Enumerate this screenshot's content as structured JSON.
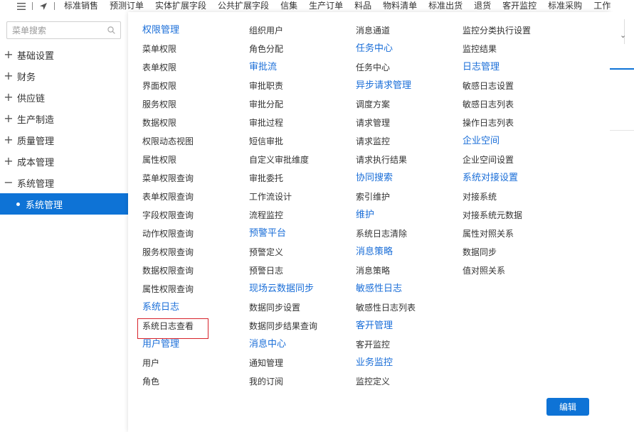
{
  "topbar": {
    "tabs": [
      "标准销售",
      "预测订单",
      "实体扩展字段",
      "公共扩展字段",
      "信集",
      "生产订单",
      "料品",
      "物料清单",
      "标准出货",
      "退货",
      "客开监控",
      "标准采购",
      "工作"
    ]
  },
  "sidebar": {
    "search_placeholder": "菜单搜索",
    "items": [
      {
        "icon": "+",
        "label": "基础设置"
      },
      {
        "icon": "+",
        "label": "财务"
      },
      {
        "icon": "+",
        "label": "供应链"
      },
      {
        "icon": "+",
        "label": "生产制造"
      },
      {
        "icon": "+",
        "label": "质量管理"
      },
      {
        "icon": "+",
        "label": "成本管理"
      },
      {
        "icon": "−",
        "label": "系统管理"
      }
    ],
    "active_item": "系统管理"
  },
  "menu": {
    "columns": [
      [
        {
          "type": "head",
          "text": "权限管理"
        },
        {
          "type": "link",
          "text": "菜单权限"
        },
        {
          "type": "link",
          "text": "表单权限"
        },
        {
          "type": "link",
          "text": "界面权限"
        },
        {
          "type": "link",
          "text": "服务权限"
        },
        {
          "type": "link",
          "text": "数据权限"
        },
        {
          "type": "link",
          "text": "权限动态视图"
        },
        {
          "type": "link",
          "text": "属性权限"
        },
        {
          "type": "link",
          "text": "菜单权限查询"
        },
        {
          "type": "link",
          "text": "表单权限查询"
        },
        {
          "type": "link",
          "text": "字段权限查询"
        },
        {
          "type": "link",
          "text": "动作权限查询"
        },
        {
          "type": "link",
          "text": "服务权限查询"
        },
        {
          "type": "link",
          "text": "数据权限查询"
        },
        {
          "type": "link",
          "text": "属性权限查询"
        },
        {
          "type": "head",
          "text": "系统日志"
        },
        {
          "type": "link",
          "text": "系统日志查看"
        },
        {
          "type": "head",
          "text": "用户管理"
        },
        {
          "type": "link",
          "text": "用户"
        },
        {
          "type": "link",
          "text": "角色"
        }
      ],
      [
        {
          "type": "link",
          "text": "组织用户"
        },
        {
          "type": "link",
          "text": "角色分配"
        },
        {
          "type": "head",
          "text": "审批流"
        },
        {
          "type": "link",
          "text": "审批职责"
        },
        {
          "type": "link",
          "text": "审批分配"
        },
        {
          "type": "link",
          "text": "审批过程"
        },
        {
          "type": "link",
          "text": "短信审批"
        },
        {
          "type": "link",
          "text": "自定义审批维度"
        },
        {
          "type": "link",
          "text": "审批委托"
        },
        {
          "type": "link",
          "text": "工作流设计"
        },
        {
          "type": "link",
          "text": "流程监控"
        },
        {
          "type": "head",
          "text": "预警平台"
        },
        {
          "type": "link",
          "text": "预警定义"
        },
        {
          "type": "link",
          "text": "预警日志"
        },
        {
          "type": "head",
          "text": "现场云数据同步"
        },
        {
          "type": "link",
          "text": "数据同步设置"
        },
        {
          "type": "link",
          "text": "数据同步结果查询"
        },
        {
          "type": "head",
          "text": "消息中心"
        },
        {
          "type": "link",
          "text": "通知管理"
        },
        {
          "type": "link",
          "text": "我的订阅"
        }
      ],
      [
        {
          "type": "link",
          "text": "消息通道"
        },
        {
          "type": "head",
          "text": "任务中心"
        },
        {
          "type": "link",
          "text": "任务中心"
        },
        {
          "type": "head",
          "text": "异步请求管理"
        },
        {
          "type": "link",
          "text": "调度方案"
        },
        {
          "type": "link",
          "text": "请求管理"
        },
        {
          "type": "link",
          "text": "请求监控"
        },
        {
          "type": "link",
          "text": "请求执行结果"
        },
        {
          "type": "head",
          "text": "协同搜索"
        },
        {
          "type": "link",
          "text": "索引维护"
        },
        {
          "type": "head",
          "text": "维护"
        },
        {
          "type": "link",
          "text": "系统日志清除"
        },
        {
          "type": "head",
          "text": "消息策略"
        },
        {
          "type": "link",
          "text": "消息策略"
        },
        {
          "type": "head",
          "text": "敏感性日志"
        },
        {
          "type": "link",
          "text": "敏感性日志列表"
        },
        {
          "type": "head",
          "text": "客开管理"
        },
        {
          "type": "link",
          "text": "客开监控"
        },
        {
          "type": "head",
          "text": "业务监控"
        },
        {
          "type": "link",
          "text": "监控定义"
        }
      ],
      [
        {
          "type": "link",
          "text": "监控分类执行设置"
        },
        {
          "type": "link",
          "text": "监控结果"
        },
        {
          "type": "head",
          "text": "日志管理"
        },
        {
          "type": "link",
          "text": "敏感日志设置"
        },
        {
          "type": "link",
          "text": "敏感日志列表"
        },
        {
          "type": "link",
          "text": "操作日志列表"
        },
        {
          "type": "head",
          "text": "企业空间"
        },
        {
          "type": "link",
          "text": "企业空间设置"
        },
        {
          "type": "head",
          "text": "系统对接设置"
        },
        {
          "type": "link",
          "text": "对接系统"
        },
        {
          "type": "link",
          "text": "对接系统元数据"
        },
        {
          "type": "link",
          "text": "属性对照关系"
        },
        {
          "type": "link",
          "text": "数据同步"
        },
        {
          "type": "link",
          "text": "值对照关系"
        }
      ]
    ],
    "edit_label": "编辑",
    "highlighted_item": "系统日志查看"
  },
  "colors": {
    "accent": "#0e73d6",
    "heading": "#1a6ed8",
    "highlight_border": "#d7222a"
  }
}
